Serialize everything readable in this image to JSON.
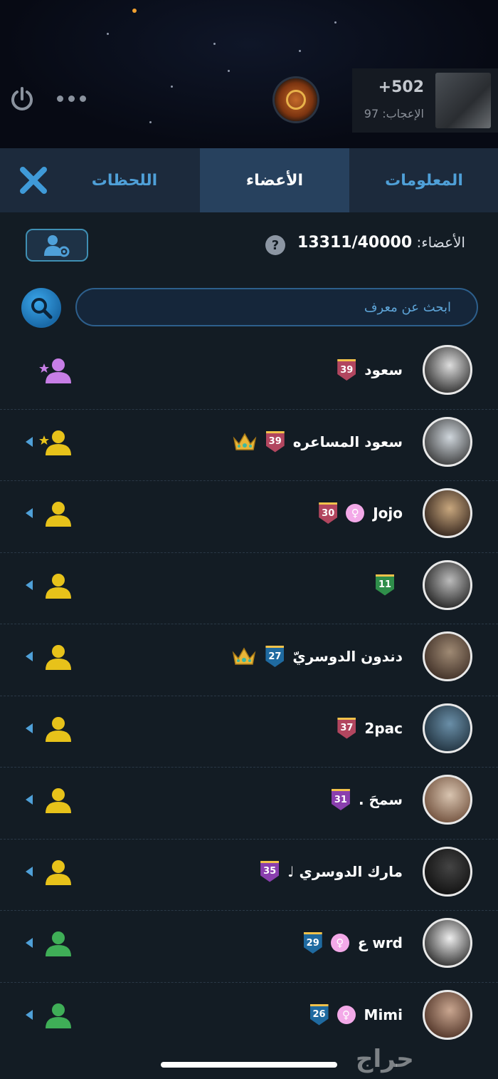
{
  "header": {
    "likes_count": "+502",
    "likes_label": "الإعجاب: 97",
    "power_icon": "power-icon",
    "more_icon": "more-dots-icon"
  },
  "tabs": [
    {
      "label": "المعلومات",
      "active": false
    },
    {
      "label": "الأعضاء",
      "active": true
    },
    {
      "label": "اللحظات",
      "active": false
    }
  ],
  "members_info": {
    "label": "الأعضاء:",
    "count": "13311/40000",
    "help": "?"
  },
  "search": {
    "placeholder": "ابحث عن معرف"
  },
  "members": [
    {
      "name": "سعود",
      "level": "39",
      "badge_color": "#b2465f",
      "gender": false,
      "crown": false,
      "role": "admin",
      "role_color": "#c77ee6",
      "expandable": false,
      "avatar": [
        "#ddd",
        "#222"
      ]
    },
    {
      "name": "سعود المساعره",
      "level": "39",
      "badge_color": "#b2465f",
      "gender": false,
      "crown": true,
      "role": "co-admin",
      "role_color": "#e7c21a",
      "expandable": true,
      "avatar": [
        "#cfd6dc",
        "#333"
      ]
    },
    {
      "name": "Jojo",
      "level": "30",
      "badge_color": "#b2465f",
      "gender": true,
      "crown": false,
      "role": "member",
      "role_color": "#e7c21a",
      "expandable": true,
      "avatar": [
        "#c8a77e",
        "#2a1c16"
      ]
    },
    {
      "name": "",
      "level": "11",
      "badge_color": "#2f8e4a",
      "gender": false,
      "crown": false,
      "role": "member",
      "role_color": "#e7c21a",
      "expandable": true,
      "avatar": [
        "#bbb",
        "#1a1a1a"
      ]
    },
    {
      "name": "دندون الدوسريّ",
      "level": "27",
      "badge_color": "#1f6aa0",
      "gender": false,
      "crown": true,
      "role": "member",
      "role_color": "#e7c21a",
      "expandable": true,
      "avatar": [
        "#9f8a74",
        "#3a2a22"
      ]
    },
    {
      "name": "2pac",
      "level": "37",
      "badge_color": "#b2465f",
      "gender": false,
      "crown": false,
      "role": "member",
      "role_color": "#e7c21a",
      "expandable": true,
      "avatar": [
        "#6a8fa8",
        "#1c2c38"
      ]
    },
    {
      "name": "سمحَ .",
      "level": "31",
      "badge_color": "#8a3fae",
      "gender": false,
      "crown": false,
      "role": "member",
      "role_color": "#e7c21a",
      "expandable": true,
      "avatar": [
        "#d8c4b0",
        "#6b4a36"
      ]
    },
    {
      "name": "مارك الدوسري ♩",
      "level": "35",
      "badge_color": "#8a3fae",
      "gender": false,
      "crown": false,
      "role": "member",
      "role_color": "#e7c21a",
      "expandable": true,
      "avatar": [
        "#444",
        "#0d0d0d"
      ]
    },
    {
      "name": "wrd ﻉ",
      "level": "29",
      "badge_color": "#1f6aa0",
      "gender": true,
      "crown": false,
      "role": "member",
      "role_color": "#3fae57",
      "expandable": true,
      "avatar": [
        "#eee",
        "#222"
      ]
    },
    {
      "name": "Mimi",
      "level": "26",
      "badge_color": "#1f6aa0",
      "gender": true,
      "crown": false,
      "role": "member",
      "role_color": "#3fae57",
      "expandable": true,
      "avatar": [
        "#c9a690",
        "#4a2e22"
      ]
    }
  ],
  "watermark": "حراج"
}
